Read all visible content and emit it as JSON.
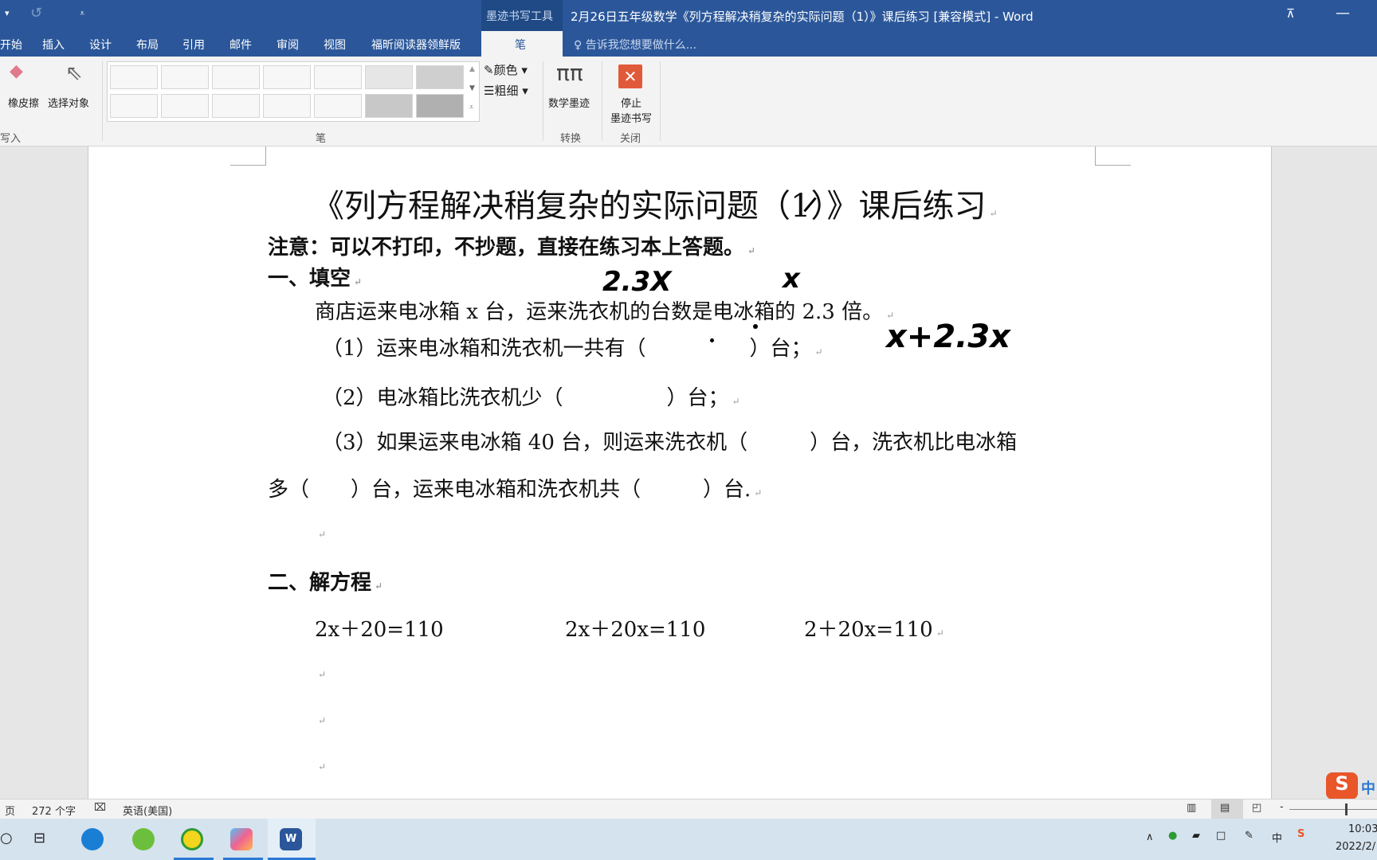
{
  "titlebar": {
    "title": "2月26日五年级数学《列方程解决稍复杂的实际问题（1）》课后练习 [兼容模式] - Word",
    "context_tab": "墨迹书写工具"
  },
  "tabs": [
    "开始",
    "插入",
    "设计",
    "布局",
    "引用",
    "邮件",
    "审阅",
    "视图",
    "福昕阅读器领鲜版",
    "笔"
  ],
  "active_tab": "笔",
  "tell_me": "告诉我您想要做什么...",
  "ribbon": {
    "eraser": "橡皮擦",
    "select": "选择对象",
    "group_write": "写入",
    "color": "颜色",
    "thickness": "粗细",
    "group_pens": "笔",
    "math_ink": "数学墨迹",
    "group_convert": "转换",
    "stop_ink_line1": "停止",
    "stop_ink_line2": "墨迹书写",
    "group_close": "关闭"
  },
  "document": {
    "title": "《列方程解决稍复杂的实际问题（1）》课后练习",
    "note": "注意：可以不打印，不抄题，直接在练习本上答题。",
    "section1": "一、填空",
    "problem": "商店运来电冰箱 x 台，运来洗衣机的台数是电冰箱的 2.3 倍。",
    "q1": "（1）运来电冰箱和洗衣机一共有（　　　　　）台；",
    "q2": "（2）电冰箱比洗衣机少（　　　　　）台；",
    "q3a": "（3）如果运来电冰箱 40 台，则运来洗衣机（　　　）台，洗衣机比电冰箱",
    "q3b": "多（　　）台，运来电冰箱和洗衣机共（　　　）台.",
    "section2": "二、解方程",
    "equations": [
      "2x＋20=110",
      "2x＋20x=110",
      "2＋20x=110"
    ],
    "paragraph_mark": "↵"
  },
  "ink": {
    "a": "2.3X",
    "b": "x",
    "c": "x+2.3x"
  },
  "status": {
    "page": "页",
    "words": "272 个字",
    "language": "英语(美国)"
  },
  "clock": {
    "time": "10:03",
    "date": "2022/2/"
  },
  "colors": {
    "brand": "#2b579a",
    "stop": "#e05a3a"
  }
}
